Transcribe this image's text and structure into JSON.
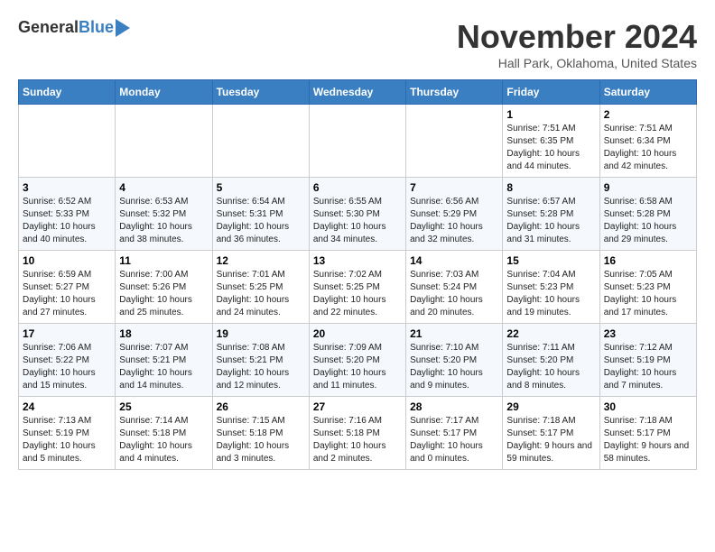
{
  "header": {
    "logo_general": "General",
    "logo_blue": "Blue",
    "month_title": "November 2024",
    "location": "Hall Park, Oklahoma, United States"
  },
  "days_of_week": [
    "Sunday",
    "Monday",
    "Tuesday",
    "Wednesday",
    "Thursday",
    "Friday",
    "Saturday"
  ],
  "weeks": [
    [
      {
        "day": "",
        "info": ""
      },
      {
        "day": "",
        "info": ""
      },
      {
        "day": "",
        "info": ""
      },
      {
        "day": "",
        "info": ""
      },
      {
        "day": "",
        "info": ""
      },
      {
        "day": "1",
        "info": "Sunrise: 7:51 AM\nSunset: 6:35 PM\nDaylight: 10 hours and 44 minutes."
      },
      {
        "day": "2",
        "info": "Sunrise: 7:51 AM\nSunset: 6:34 PM\nDaylight: 10 hours and 42 minutes."
      }
    ],
    [
      {
        "day": "3",
        "info": "Sunrise: 6:52 AM\nSunset: 5:33 PM\nDaylight: 10 hours and 40 minutes."
      },
      {
        "day": "4",
        "info": "Sunrise: 6:53 AM\nSunset: 5:32 PM\nDaylight: 10 hours and 38 minutes."
      },
      {
        "day": "5",
        "info": "Sunrise: 6:54 AM\nSunset: 5:31 PM\nDaylight: 10 hours and 36 minutes."
      },
      {
        "day": "6",
        "info": "Sunrise: 6:55 AM\nSunset: 5:30 PM\nDaylight: 10 hours and 34 minutes."
      },
      {
        "day": "7",
        "info": "Sunrise: 6:56 AM\nSunset: 5:29 PM\nDaylight: 10 hours and 32 minutes."
      },
      {
        "day": "8",
        "info": "Sunrise: 6:57 AM\nSunset: 5:28 PM\nDaylight: 10 hours and 31 minutes."
      },
      {
        "day": "9",
        "info": "Sunrise: 6:58 AM\nSunset: 5:28 PM\nDaylight: 10 hours and 29 minutes."
      }
    ],
    [
      {
        "day": "10",
        "info": "Sunrise: 6:59 AM\nSunset: 5:27 PM\nDaylight: 10 hours and 27 minutes."
      },
      {
        "day": "11",
        "info": "Sunrise: 7:00 AM\nSunset: 5:26 PM\nDaylight: 10 hours and 25 minutes."
      },
      {
        "day": "12",
        "info": "Sunrise: 7:01 AM\nSunset: 5:25 PM\nDaylight: 10 hours and 24 minutes."
      },
      {
        "day": "13",
        "info": "Sunrise: 7:02 AM\nSunset: 5:25 PM\nDaylight: 10 hours and 22 minutes."
      },
      {
        "day": "14",
        "info": "Sunrise: 7:03 AM\nSunset: 5:24 PM\nDaylight: 10 hours and 20 minutes."
      },
      {
        "day": "15",
        "info": "Sunrise: 7:04 AM\nSunset: 5:23 PM\nDaylight: 10 hours and 19 minutes."
      },
      {
        "day": "16",
        "info": "Sunrise: 7:05 AM\nSunset: 5:23 PM\nDaylight: 10 hours and 17 minutes."
      }
    ],
    [
      {
        "day": "17",
        "info": "Sunrise: 7:06 AM\nSunset: 5:22 PM\nDaylight: 10 hours and 15 minutes."
      },
      {
        "day": "18",
        "info": "Sunrise: 7:07 AM\nSunset: 5:21 PM\nDaylight: 10 hours and 14 minutes."
      },
      {
        "day": "19",
        "info": "Sunrise: 7:08 AM\nSunset: 5:21 PM\nDaylight: 10 hours and 12 minutes."
      },
      {
        "day": "20",
        "info": "Sunrise: 7:09 AM\nSunset: 5:20 PM\nDaylight: 10 hours and 11 minutes."
      },
      {
        "day": "21",
        "info": "Sunrise: 7:10 AM\nSunset: 5:20 PM\nDaylight: 10 hours and 9 minutes."
      },
      {
        "day": "22",
        "info": "Sunrise: 7:11 AM\nSunset: 5:20 PM\nDaylight: 10 hours and 8 minutes."
      },
      {
        "day": "23",
        "info": "Sunrise: 7:12 AM\nSunset: 5:19 PM\nDaylight: 10 hours and 7 minutes."
      }
    ],
    [
      {
        "day": "24",
        "info": "Sunrise: 7:13 AM\nSunset: 5:19 PM\nDaylight: 10 hours and 5 minutes."
      },
      {
        "day": "25",
        "info": "Sunrise: 7:14 AM\nSunset: 5:18 PM\nDaylight: 10 hours and 4 minutes."
      },
      {
        "day": "26",
        "info": "Sunrise: 7:15 AM\nSunset: 5:18 PM\nDaylight: 10 hours and 3 minutes."
      },
      {
        "day": "27",
        "info": "Sunrise: 7:16 AM\nSunset: 5:18 PM\nDaylight: 10 hours and 2 minutes."
      },
      {
        "day": "28",
        "info": "Sunrise: 7:17 AM\nSunset: 5:17 PM\nDaylight: 10 hours and 0 minutes."
      },
      {
        "day": "29",
        "info": "Sunrise: 7:18 AM\nSunset: 5:17 PM\nDaylight: 9 hours and 59 minutes."
      },
      {
        "day": "30",
        "info": "Sunrise: 7:18 AM\nSunset: 5:17 PM\nDaylight: 9 hours and 58 minutes."
      }
    ]
  ]
}
